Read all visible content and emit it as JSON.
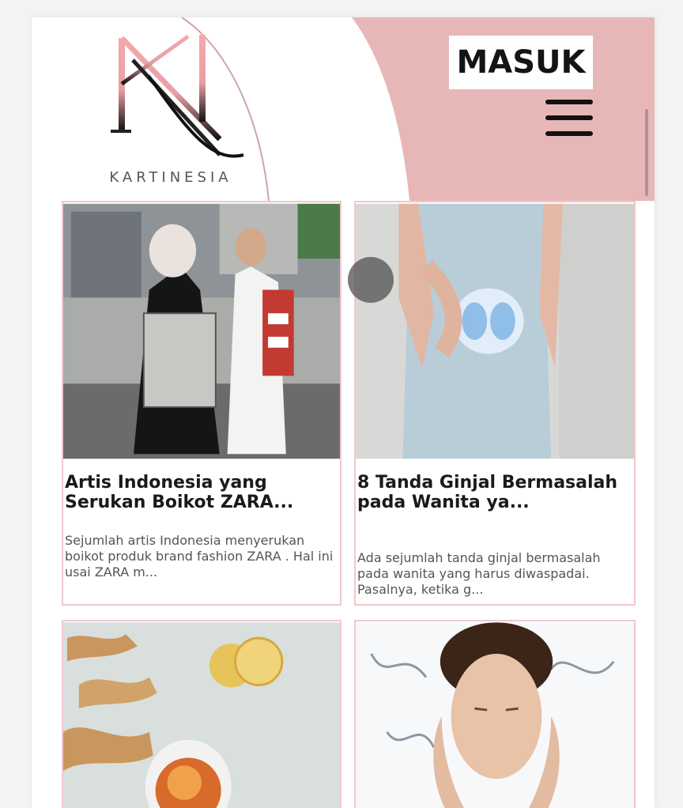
{
  "header": {
    "brand": "KARTINESIA",
    "login_label": "MASUK",
    "accent_color": "#e8b8b9"
  },
  "articles": [
    {
      "title": "Artis Indonesia yang Serukan Boikot ZARA...",
      "excerpt": "Sejumlah artis Indonesia menyerukan boikot produk brand fashion ZARA . Hal ini usai ZARA m...",
      "image": "protest-photo"
    },
    {
      "title": "8 Tanda Ginjal Bermasalah pada Wanita ya...",
      "excerpt": "Ada sejumlah tanda ginjal bermasalah pada wanita yang harus diwaspadai. Pasalnya, ketika g...",
      "image": "kidney-illustration-photo"
    },
    {
      "title": "",
      "excerpt": "",
      "image": "ginger-lemon-tea-photo"
    },
    {
      "title": "",
      "excerpt": "",
      "image": "face-splash-photo"
    }
  ],
  "icons": {
    "menu": "hamburger-menu-icon",
    "logo": "kn-logo"
  }
}
